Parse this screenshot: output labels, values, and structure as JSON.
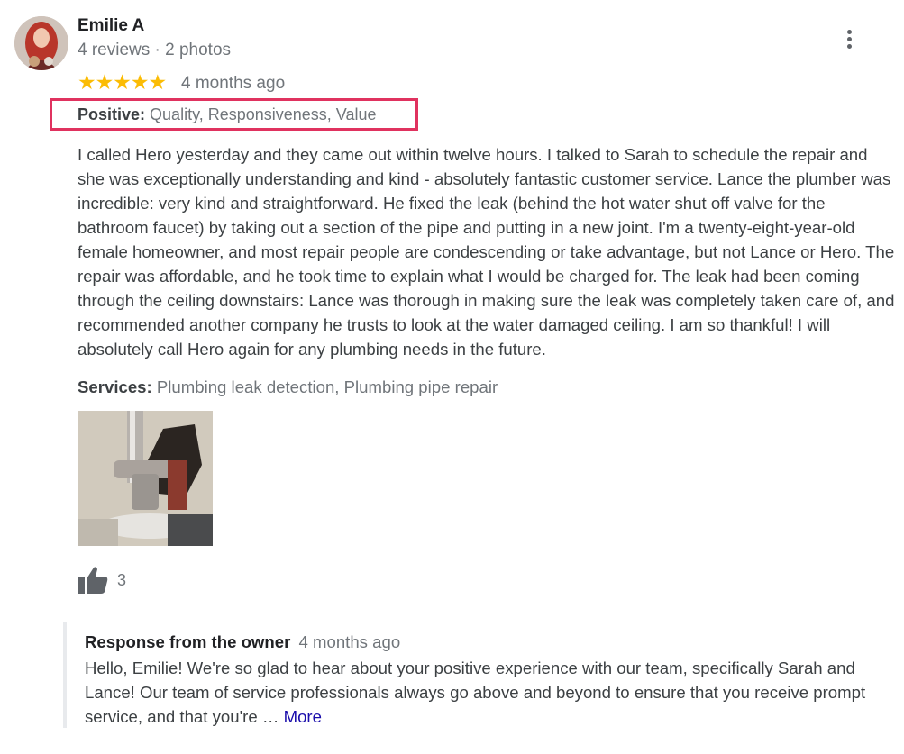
{
  "reviewer": {
    "name": "Emilie A",
    "meta": "4 reviews · 2 photos"
  },
  "rating": {
    "stars": 5,
    "stars_text": "★★★★★",
    "time_ago": "4 months ago"
  },
  "positive": {
    "label": "Positive:",
    "value": "Quality, Responsiveness, Value",
    "highlight_color": "#e0325f"
  },
  "review_text": "I called Hero yesterday and they came out within twelve hours. I talked to Sarah to schedule the repair and she was exceptionally understanding and kind - absolutely fantastic customer service. Lance the plumber was incredible: very kind and straightforward. He fixed the leak (behind the hot water shut off valve for the bathroom faucet) by taking out a section of the pipe and putting in a new joint. I'm a twenty-eight-year-old female homeowner, and most repair people are condescending or take advantage, but not Lance or Hero. The repair was affordable, and he took time to explain what I would be charged for. The leak had been coming through the ceiling downstairs: Lance was thorough in making sure the leak was completely taken care of, and recommended another company he trusts to look at the water damaged ceiling. I am so thankful! I will absolutely call Hero again for any plumbing needs in the future.",
  "services": {
    "label": "Services:",
    "value": "Plumbing leak detection, Plumbing pipe repair"
  },
  "photo": {
    "icon": "pipe-repair-photo"
  },
  "likes": {
    "icon": "thumbs-up-icon",
    "count": "3"
  },
  "owner_response": {
    "title": "Response from the owner",
    "time_ago": "4 months ago",
    "text": "Hello, Emilie! We're so glad to hear about your positive experience with our team, specifically Sarah and Lance! Our team of service professionals always go above and beyond to ensure that you receive prompt service, and that you're … ",
    "more_label": "More"
  },
  "colors": {
    "star": "#fbbc04",
    "link": "#1a0dab",
    "muted": "#70757a"
  }
}
